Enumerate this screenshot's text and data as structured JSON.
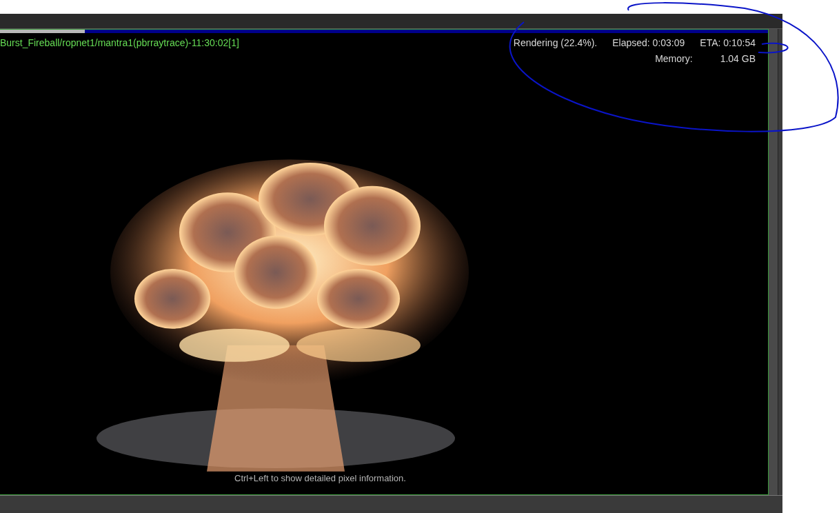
{
  "render_view": {
    "title": "Burst_Fireball/ropnet1/mantra1(pbrraytrace)-11:30:02[1]",
    "progress": {
      "level": 0.11
    },
    "status": "Rendering (22.4%).",
    "elapsed": "Elapsed: 0:03:09",
    "eta": "ETA: 0:10:54",
    "memory_label": "Memory:",
    "memory_value": "1.04 GB",
    "hint": "Ctrl+Left to show detailed pixel information."
  }
}
